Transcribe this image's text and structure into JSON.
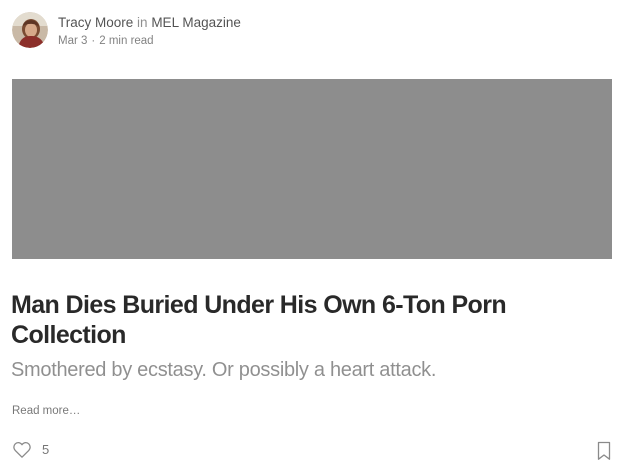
{
  "post": {
    "author": "Tracy Moore",
    "in_word": "in",
    "publication": "MEL Magazine",
    "date": "Mar 3",
    "separator": "·",
    "read_time": "2 min read",
    "title": "Man Dies Buried Under His Own 6-Ton Porn Collection",
    "subtitle": "Smothered by ecstasy. Or possibly a heart attack.",
    "read_more": "Read more…"
  },
  "actions": {
    "clap_icon": "heart-icon",
    "clap_count": "5",
    "bookmark_icon": "bookmark-icon"
  },
  "colors": {
    "hero_placeholder": "#8d8d8d",
    "text_primary": "#1f1f1f",
    "text_muted": "#8a8a8a"
  }
}
